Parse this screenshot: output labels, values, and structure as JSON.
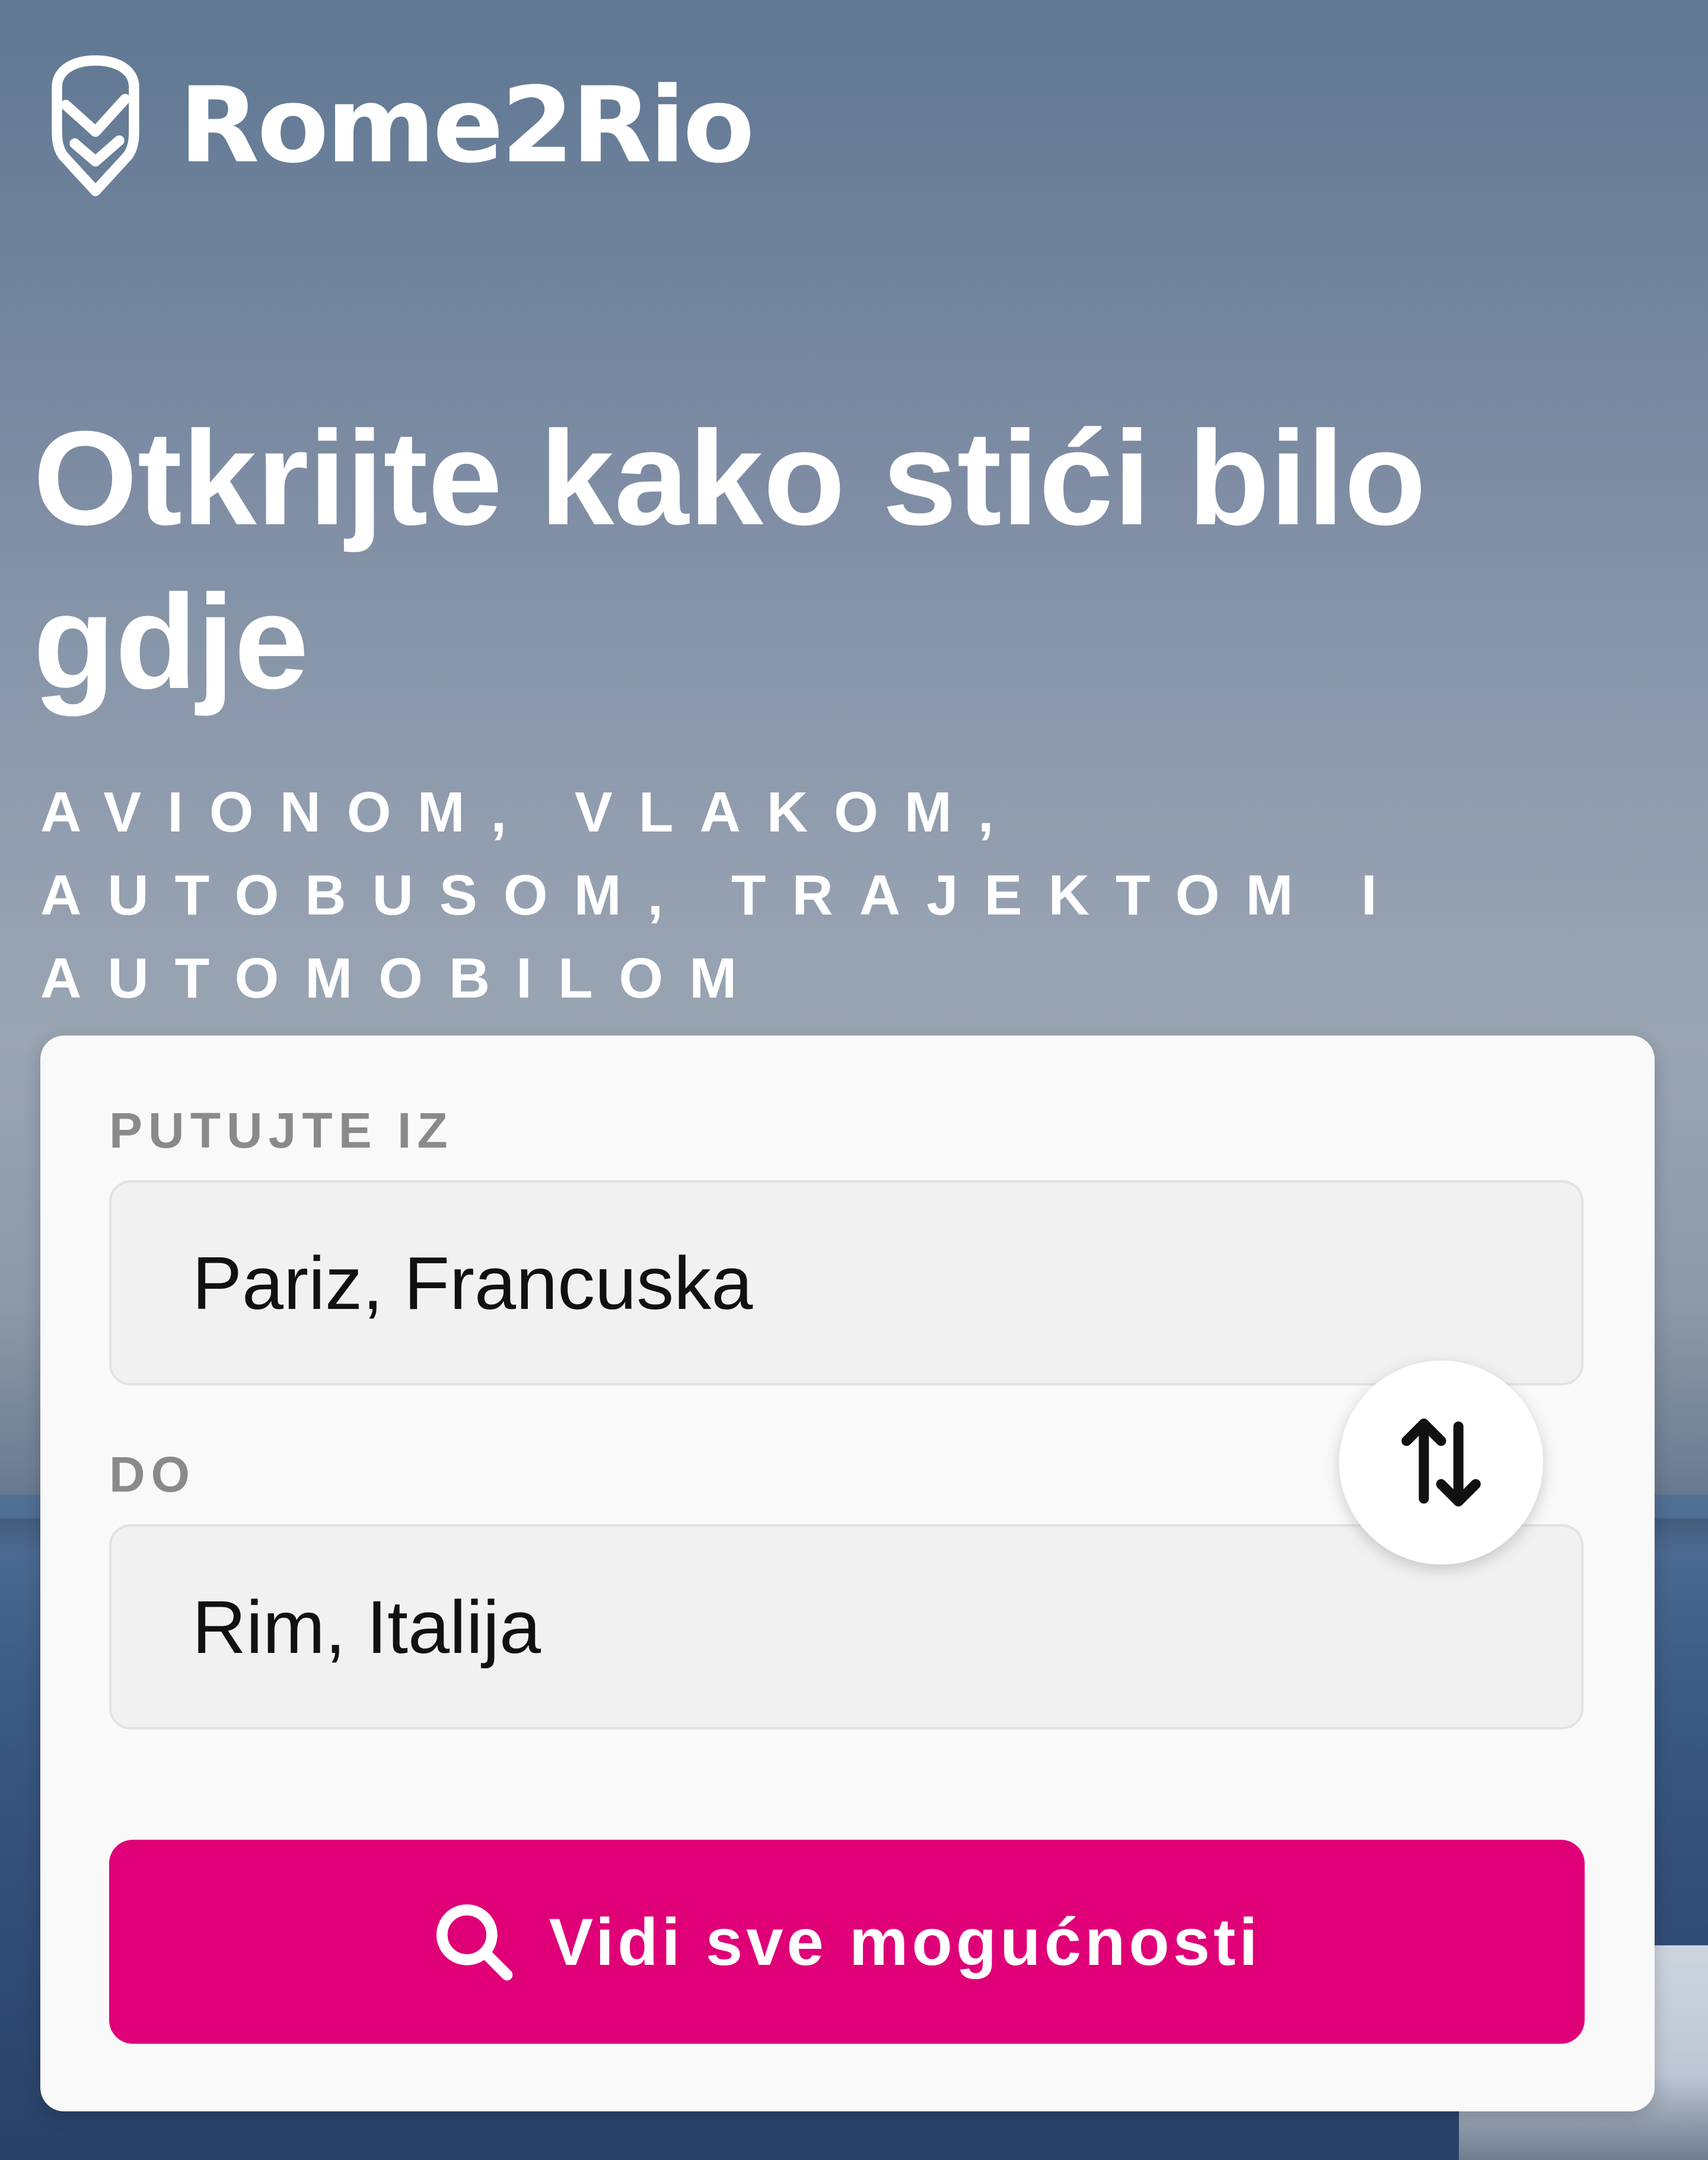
{
  "brand": {
    "name": "Rome2Rio",
    "logo_icon": "map-pin-check-icon"
  },
  "hero": {
    "headline": "Otkrijte kako stići bilo gdje",
    "subheadline": "AVIONOM, VLAKOM, AUTOBUSOM, TRAJEKTOM I AUTOMOBILOM"
  },
  "search_form": {
    "from_label": "PUTUJTE IZ",
    "from_value": "Pariz, Francuska",
    "to_label": "DO",
    "to_value": "Rim, Italija",
    "swap_icon": "swap-vertical-arrows-icon",
    "submit_label": "Vidi sve mogućnosti",
    "submit_icon": "search-icon"
  },
  "colors": {
    "accent": "#DF0078",
    "card_background": "#F9F9F9",
    "field_background": "#F1F1F1"
  }
}
